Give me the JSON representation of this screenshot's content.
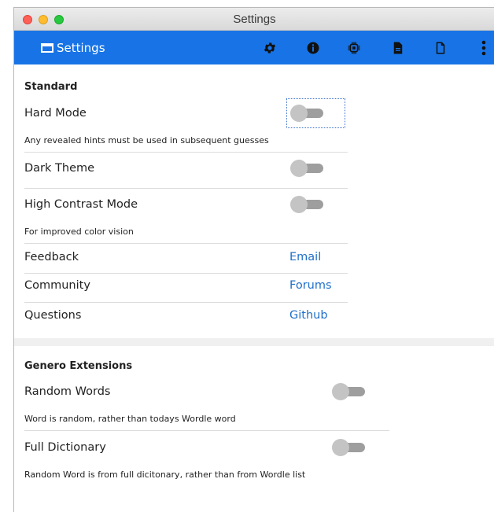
{
  "window": {
    "title": "Settings"
  },
  "appbar": {
    "title": "Settings",
    "icons": [
      "settings-gear-icon",
      "info-icon",
      "chip-icon",
      "document-filled-icon",
      "document-outline-icon",
      "more-vertical-icon"
    ],
    "background": "#1874e6"
  },
  "standard": {
    "title": "Standard",
    "hard_mode": {
      "label": "Hard Mode",
      "hint": "Any revealed hints must be used in subsequent guesses",
      "enabled": false
    },
    "dark_theme": {
      "label": "Dark Theme",
      "enabled": false
    },
    "high_contrast": {
      "label": "High Contrast Mode",
      "hint": "For improved color vision",
      "enabled": false
    },
    "feedback": {
      "label": "Feedback",
      "link": "Email"
    },
    "community": {
      "label": "Community",
      "link": "Forums"
    },
    "questions": {
      "label": "Questions",
      "link": "Github"
    }
  },
  "genero": {
    "title": "Genero Extensions",
    "random_words": {
      "label": "Random Words",
      "hint": "Word is random, rather than todays Wordle word",
      "enabled": false
    },
    "full_dictionary": {
      "label": "Full Dictionary",
      "hint": "Random Word is from full dicitonary, rather than from Wordle list",
      "enabled": false
    }
  },
  "colors": {
    "link": "#1f6fc9",
    "toggle_track": "#9e9e9e",
    "toggle_thumb": "#c4c4c4"
  }
}
